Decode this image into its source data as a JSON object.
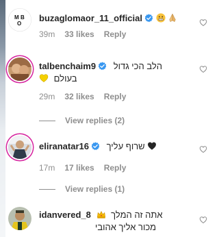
{
  "comments": [
    {
      "username": "buzaglomaor_11_official",
      "text": "",
      "emojis": [
        "grimace-face",
        "praying-hands"
      ],
      "time": "39m",
      "likes": "33 likes",
      "reply": "Reply",
      "avatar_text": "MBO"
    },
    {
      "username": "talbenchaim9",
      "text": "הלב הכי גדול",
      "text2": "בעולם",
      "emojis": [
        "yellow-heart"
      ],
      "time": "29m",
      "likes": "32 likes",
      "reply": "Reply",
      "view_replies": "View replies (2)"
    },
    {
      "username": "eliranatar16",
      "text": "שרוף עליך",
      "emojis": [
        "black-heart"
      ],
      "time": "17m",
      "likes": "17 likes",
      "reply": "Reply",
      "view_replies": "View replies (1)"
    },
    {
      "username": "idanvered_8",
      "text": "אתה זה המלך",
      "text2": "מכור אליך אהובי",
      "emojis": [
        "crown"
      ]
    }
  ],
  "colors": {
    "verified": "#3897f0",
    "secondary_text": "#8e8e8e",
    "primary_text": "#262626",
    "story_ring": "#d6249f"
  }
}
